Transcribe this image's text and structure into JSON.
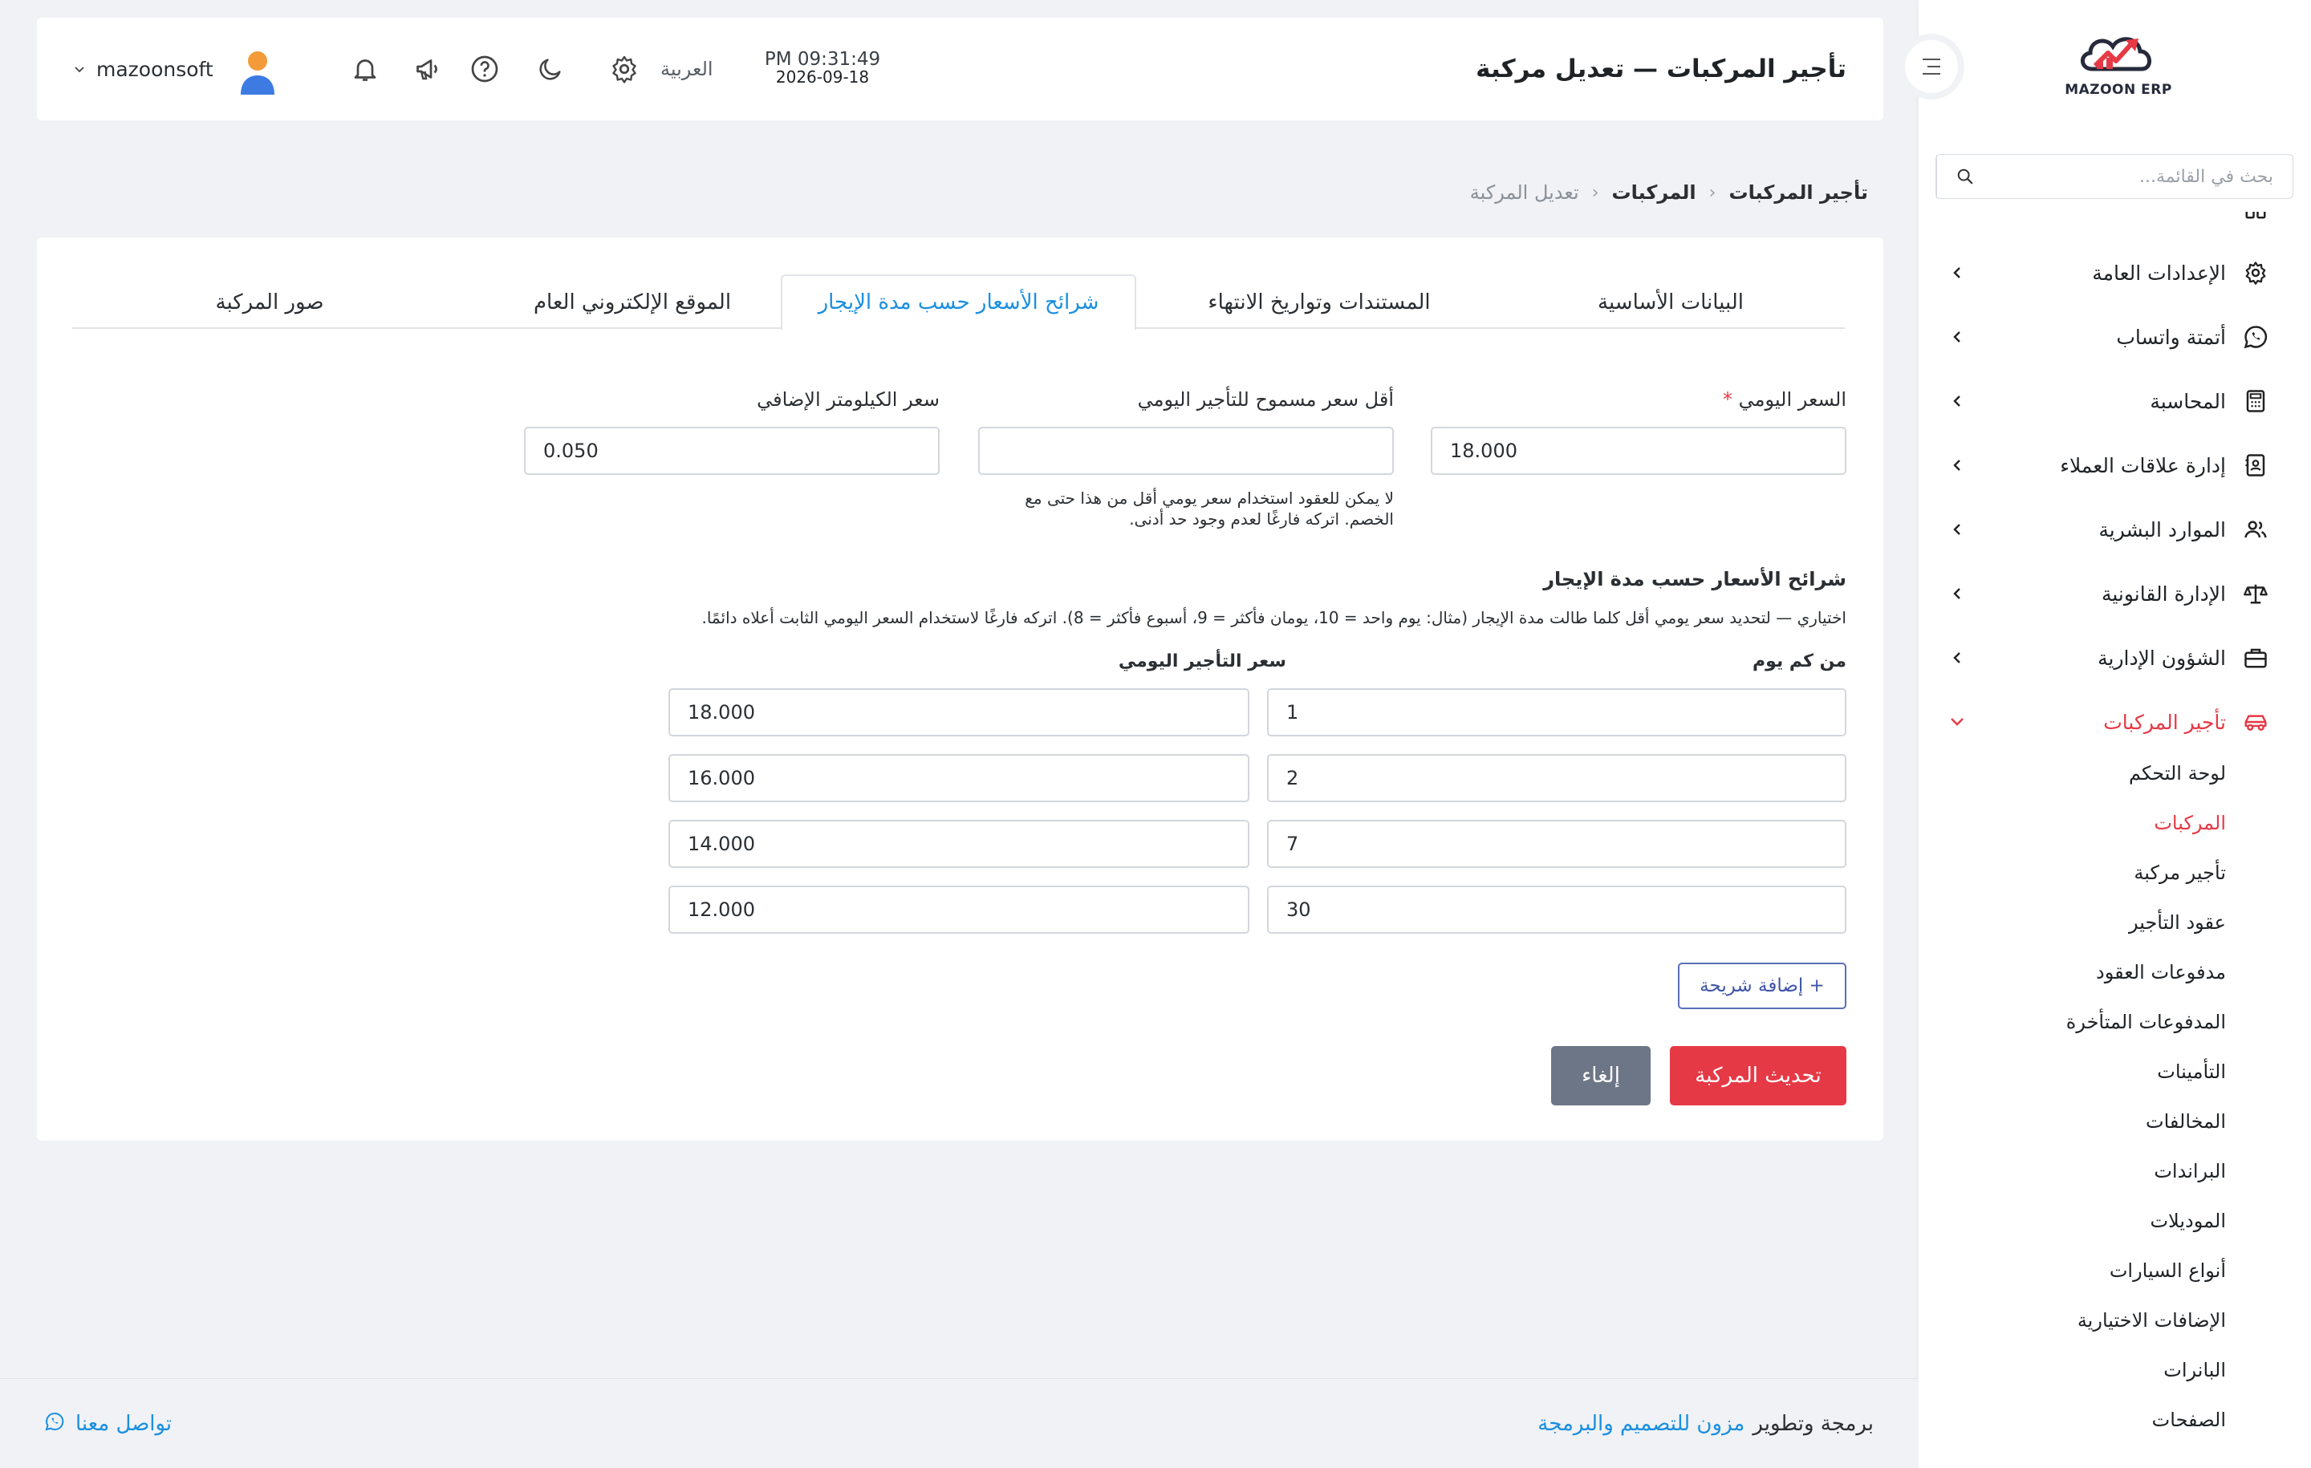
{
  "colors": {
    "accent": "#e63946",
    "link": "#1a8fe0",
    "background": "#f0f2f5"
  },
  "sidebar": {
    "logo_text": "MAZOON ERP",
    "search_placeholder": "بحث في القائمة...",
    "items": [
      {
        "label": "الإعدادات العامة",
        "icon": "gear-icon"
      },
      {
        "label": "أتمتة واتساب",
        "icon": "whatsapp-icon"
      },
      {
        "label": "المحاسبة",
        "icon": "calculator-icon"
      },
      {
        "label": "إدارة علاقات العملاء",
        "icon": "contact-card-icon"
      },
      {
        "label": "الموارد البشرية",
        "icon": "users-icon"
      },
      {
        "label": "الإدارة القانونية",
        "icon": "scales-icon"
      },
      {
        "label": "الشؤون الإدارية",
        "icon": "briefcase-icon"
      },
      {
        "label": "تأجير المركبات",
        "icon": "car-icon",
        "active": true
      }
    ],
    "submenu": [
      {
        "label": "لوحة التحكم"
      },
      {
        "label": "المركبات",
        "active": true
      },
      {
        "label": "تأجير مركبة"
      },
      {
        "label": "عقود التأجير"
      },
      {
        "label": "مدفوعات العقود"
      },
      {
        "label": "المدفوعات المتأخرة"
      },
      {
        "label": "التأمينات"
      },
      {
        "label": "المخالفات"
      },
      {
        "label": "البراندات"
      },
      {
        "label": "الموديلات"
      },
      {
        "label": "أنواع السيارات"
      },
      {
        "label": "الإضافات الاختيارية"
      },
      {
        "label": "البانرات"
      },
      {
        "label": "الصفحات"
      }
    ]
  },
  "header": {
    "title": "تأجير المركبات — تعديل مركبة",
    "time": "PM 09:31:49",
    "date": "2026-09-18",
    "language": "العربية",
    "username": "mazoonsoft"
  },
  "breadcrumb": {
    "root": "تأجير المركبات",
    "parent": "المركبات",
    "current": "تعديل المركبة"
  },
  "tabs": [
    {
      "label": "البيانات الأساسية"
    },
    {
      "label": "المستندات وتواريخ الانتهاء"
    },
    {
      "label": "شرائح الأسعار حسب مدة الإيجار",
      "active": true
    },
    {
      "label": "الموقع الإلكتروني العام"
    },
    {
      "label": "صور المركبة"
    }
  ],
  "form": {
    "daily_price": {
      "label": "السعر اليومي",
      "required_mark": "*",
      "value": "18.000"
    },
    "min_daily_price": {
      "label": "أقل سعر مسموح للتأجير اليومي",
      "value": "",
      "hint_line1": "لا يمكن للعقود استخدام سعر يومي أقل من هذا حتى مع",
      "hint_line2": "الخصم. اتركه فارغًا لعدم وجود حد أدنى."
    },
    "extra_km_price": {
      "label": "سعر الكيلومتر الإضافي",
      "value": "0.050"
    }
  },
  "tiers": {
    "title": "شرائح الأسعار حسب مدة الإيجار",
    "description": "اختياري — لتحديد سعر يومي أقل كلما طالت مدة الإيجار (مثال: يوم واحد = 10، يومان فأكثر = 9، أسبوع فأكثر = 8). اتركه فارغًا لاستخدام السعر اليومي الثابت أعلاه دائمًا.",
    "col_from_days": "من كم يوم",
    "col_daily_rate": "سعر التأجير اليومي",
    "rows": [
      {
        "from_days": "1",
        "rate": "18.000"
      },
      {
        "from_days": "2",
        "rate": "16.000"
      },
      {
        "from_days": "7",
        "rate": "14.000"
      },
      {
        "from_days": "30",
        "rate": "12.000"
      }
    ],
    "add_button": "+ إضافة شريحة"
  },
  "actions": {
    "update": "تحديث المركبة",
    "cancel": "إلغاء"
  },
  "footer": {
    "credit_prefix": "برمجة وتطوير",
    "credit_link": "مزون للتصميم والبرمجة",
    "contact": "تواصل معنا"
  }
}
